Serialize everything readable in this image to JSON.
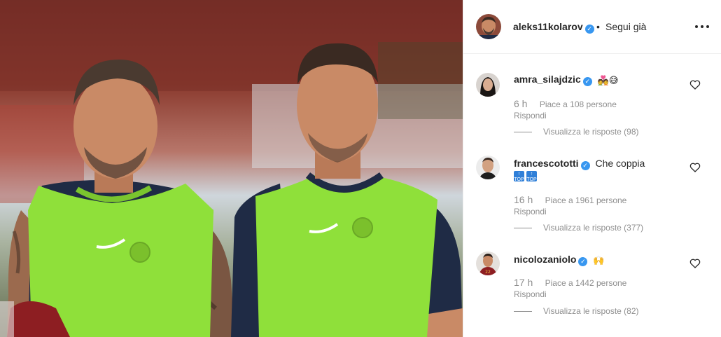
{
  "photo": {
    "alt_icon": "photo-two-players",
    "colors": {
      "vest": "#8fe03a",
      "shirt": "#1f2b45",
      "skin": "#c98a66",
      "hair": "#3a2a22",
      "bg_top": "#6e2a24",
      "bg_bottom": "#5f6a4a"
    }
  },
  "header": {
    "username": "aleks11kolarov",
    "verified_icon": "verified-badge-icon",
    "separator": "•",
    "follow_label": "Segui già",
    "more_icon": "more-options-icon"
  },
  "comments": [
    {
      "username": "amra_silajdzic",
      "text": "",
      "emojis": [
        "💑",
        "😅"
      ],
      "time": "6 h",
      "likes": "Piace a 108 persone",
      "reply_label": "Rispondi",
      "view_replies": "Visualizza le risposte (98)"
    },
    {
      "username": "francescototti",
      "text": "Che coppia",
      "badges": [
        "TOP",
        "TOP"
      ],
      "time": "16 h",
      "likes": "Piace a 1961 persone",
      "reply_label": "Rispondi",
      "view_replies": "Visualizza le risposte (377)"
    },
    {
      "username": "nicolozaniolo",
      "text": "",
      "emojis": [
        "🙌"
      ],
      "time": "17 h",
      "likes": "Piace a 1442 persone",
      "reply_label": "Rispondi",
      "view_replies": "Visualizza le risposte (82)"
    }
  ],
  "colors": {
    "text": "#262626",
    "muted": "#8e8e8e",
    "verified": "#3897f0",
    "divider": "#efefef"
  }
}
